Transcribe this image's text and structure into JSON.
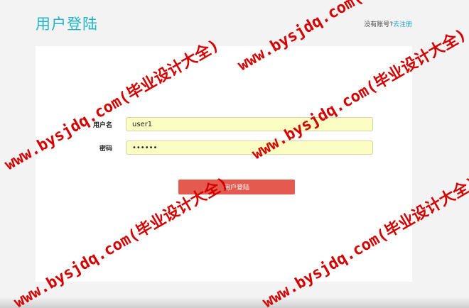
{
  "header": {
    "title": "用户登陆",
    "register_prompt": "没有账号?",
    "register_link": "去注册"
  },
  "form": {
    "username_label": "用户名",
    "username_value": "user1",
    "password_label": "密码",
    "password_value": "123456",
    "submit_label": "用户登陆"
  },
  "watermark": {
    "text": "www.bysjdq.com(毕业设计大全)",
    "color": "#d40000"
  },
  "colors": {
    "title": "#1fb5c9",
    "button": "#e45a4f",
    "input_bg": "#fbfdc2"
  }
}
